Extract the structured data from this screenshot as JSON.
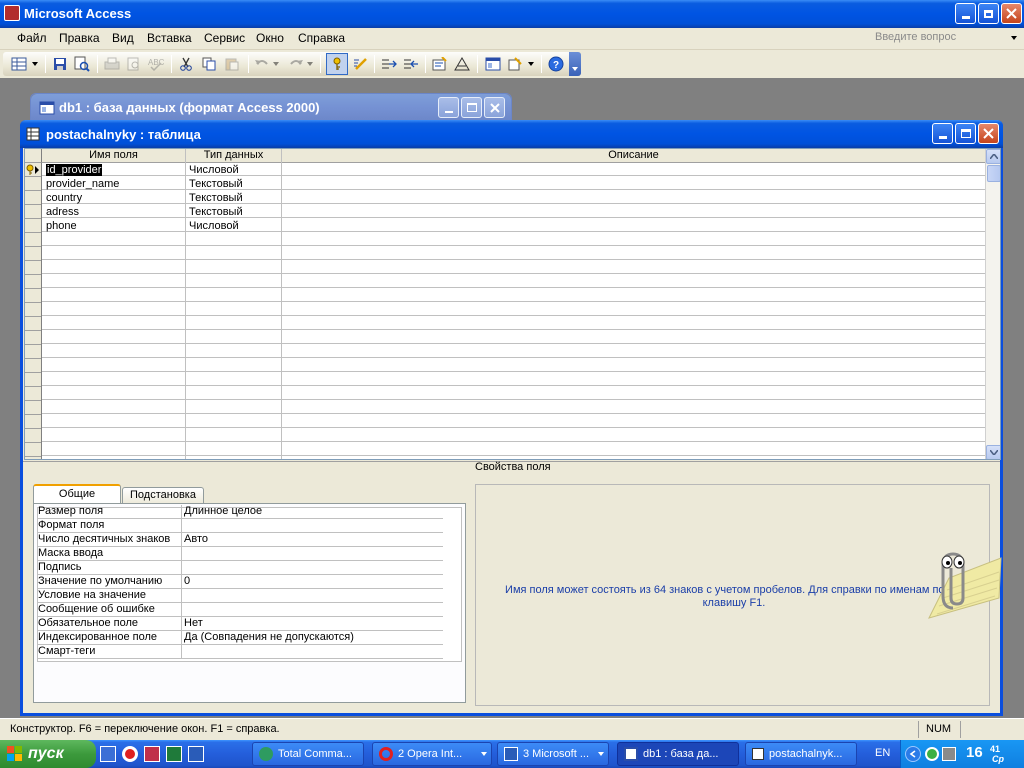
{
  "app": {
    "title": "Microsoft Access"
  },
  "menu": {
    "items": [
      "Файл",
      "Правка",
      "Вид",
      "Вставка",
      "Сервис",
      "Окно",
      "Справка"
    ],
    "help_placeholder": "Введите вопрос"
  },
  "db_window": {
    "title": "db1 : база данных (формат Access 2000)"
  },
  "table_window": {
    "title": "postachalnyky : таблица",
    "columns": [
      "Имя поля",
      "Тип данных",
      "Описание"
    ],
    "rows": [
      {
        "name": "id_provider",
        "type": "Числовой",
        "desc": ""
      },
      {
        "name": "provider_name",
        "type": "Текстовый",
        "desc": ""
      },
      {
        "name": "country",
        "type": "Текстовый",
        "desc": ""
      },
      {
        "name": "adress",
        "type": "Текстовый",
        "desc": ""
      },
      {
        "name": "phone",
        "type": "Числовой",
        "desc": ""
      }
    ],
    "field_props_label": "Свойства поля",
    "tabs": [
      "Общие",
      "Подстановка"
    ],
    "props": [
      {
        "label": "Размер поля",
        "value": "Длинное целое"
      },
      {
        "label": "Формат поля",
        "value": ""
      },
      {
        "label": "Число десятичных знаков",
        "value": "Авто"
      },
      {
        "label": "Маска ввода",
        "value": ""
      },
      {
        "label": "Подпись",
        "value": ""
      },
      {
        "label": "Значение по умолчанию",
        "value": "0"
      },
      {
        "label": "Условие на значение",
        "value": ""
      },
      {
        "label": "Сообщение об ошибке",
        "value": ""
      },
      {
        "label": "Обязательное поле",
        "value": "Нет"
      },
      {
        "label": "Индексированное поле",
        "value": "Да (Совпадения не допускаются)"
      },
      {
        "label": "Смарт-теги",
        "value": ""
      }
    ],
    "help_text_line1": "Имя поля может состоять из 64 знаков с учетом пробелов.  Для справки по именам полей",
    "help_text_line2": "клавишу F1."
  },
  "status": {
    "text": "Конструктор.  F6 = переключение окон.  F1 = справка.",
    "num": "NUM"
  },
  "taskbar": {
    "start": "пуск",
    "tasks": [
      "Total Comma...",
      "2 Opera Int...",
      "3 Microsoft ...",
      "db1 : база да...",
      "postachalnyk..."
    ],
    "lang": "EN",
    "clock": "16",
    "clock_min": "41",
    "clock_day": "Ср"
  }
}
